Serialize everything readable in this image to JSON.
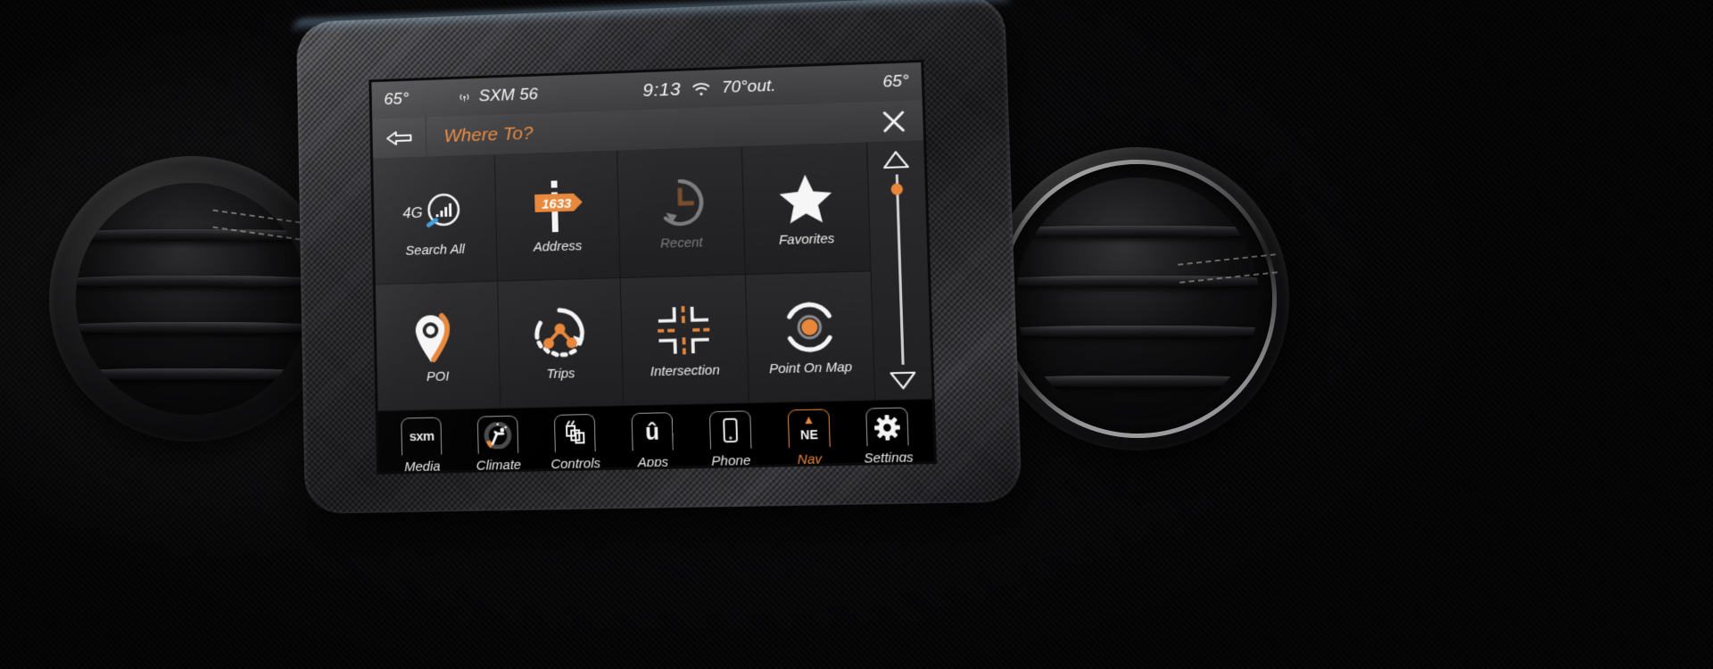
{
  "status_bar": {
    "temp_left": "65°",
    "radio_icon": "broadcast-icon",
    "radio_label": "SXM 56",
    "clock": "9:13",
    "wifi_icon": "wifi-icon",
    "outside_temp": "70°out.",
    "temp_right": "65°"
  },
  "title_bar": {
    "back_icon": "back-arrow-icon",
    "title": "Where To?",
    "close_icon": "close-x-icon"
  },
  "grid": {
    "tiles": [
      {
        "label": "Search All",
        "icon": "signal-4g-icon",
        "disabled": false
      },
      {
        "label": "Address",
        "icon": "street-sign-icon",
        "disabled": false,
        "sign_number": "1633"
      },
      {
        "label": "Recent",
        "icon": "clock-history-icon",
        "disabled": true
      },
      {
        "label": "Favorites",
        "icon": "star-icon",
        "disabled": false
      },
      {
        "label": "POI",
        "icon": "map-pin-icon",
        "disabled": false
      },
      {
        "label": "Trips",
        "icon": "trips-route-icon",
        "disabled": false
      },
      {
        "label": "Intersection",
        "icon": "intersection-icon",
        "disabled": false
      },
      {
        "label": "Point On Map",
        "icon": "point-on-map-icon",
        "disabled": false
      }
    ]
  },
  "scrollbar": {
    "up_icon": "triangle-up-icon",
    "down_icon": "triangle-down-icon"
  },
  "bottom_bar": {
    "items": [
      {
        "label": "Media",
        "icon": "sxm-logo-icon",
        "glyph": "sxm",
        "active": false
      },
      {
        "label": "Climate",
        "icon": "climate-seat-icon",
        "active": false
      },
      {
        "label": "Controls",
        "icon": "controls-icon",
        "active": false
      },
      {
        "label": "Apps",
        "icon": "apps-u-icon",
        "glyph": "û",
        "active": false
      },
      {
        "label": "Phone",
        "icon": "phone-icon",
        "active": false
      },
      {
        "label": "Nav",
        "icon": "compass-ne-icon",
        "glyph": "NE",
        "active": true
      },
      {
        "label": "Settings",
        "icon": "gear-icon",
        "active": false
      }
    ]
  },
  "colors": {
    "accent_orange": "#e8873a",
    "screen_bg": "#222224",
    "text_white": "#efefef"
  }
}
